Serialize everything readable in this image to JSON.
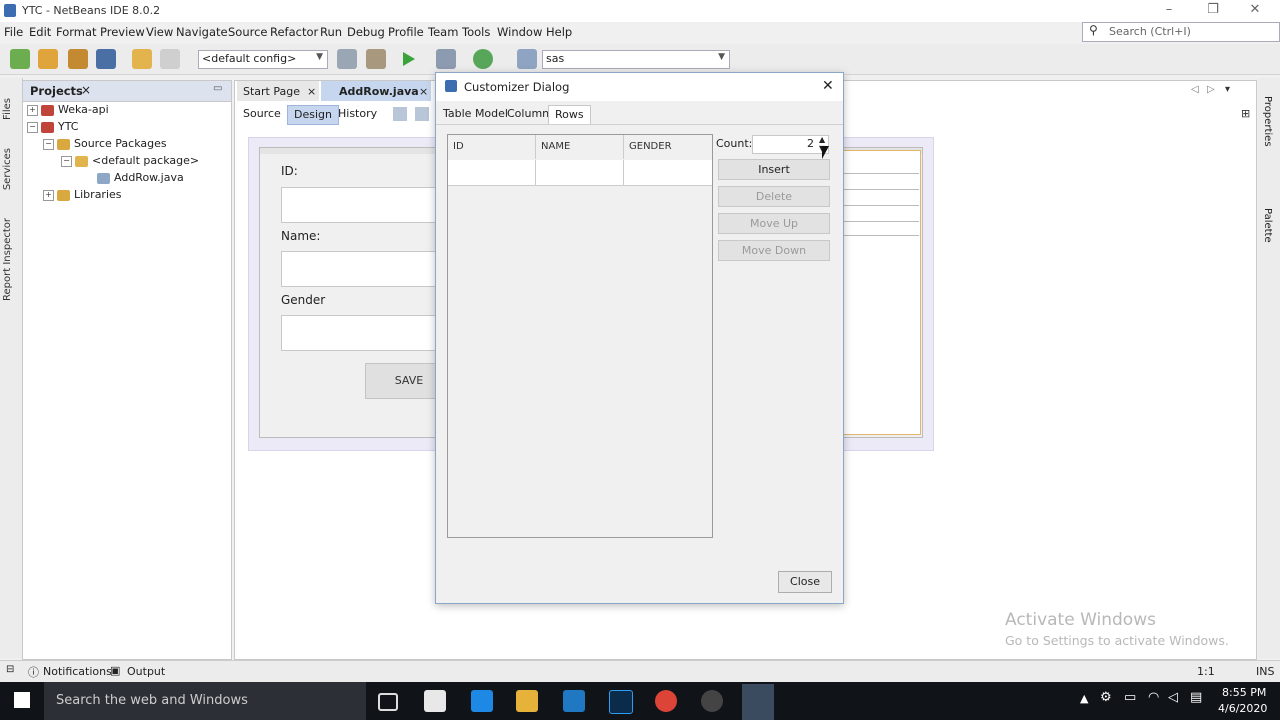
{
  "window": {
    "title": "YTC - NetBeans IDE 8.0.2",
    "search_placeholder": "Search (Ctrl+I)",
    "minimize": "–",
    "restore": "❐",
    "close": "✕"
  },
  "menu": [
    "File",
    "Edit",
    "Format",
    "Preview",
    "View",
    "Navigate",
    "Source",
    "Refactor",
    "Run",
    "Debug",
    "Profile",
    "Team",
    "Tools",
    "Window",
    "Help"
  ],
  "toolbar": {
    "config_combo": "<default config>",
    "profile_combo": "sas"
  },
  "side_tabs_left": [
    "Files",
    "Services",
    "Report Inspector"
  ],
  "side_tabs_right": [
    "Properties",
    "Palette"
  ],
  "projects": {
    "title": "Projects",
    "close": "×",
    "tree": [
      "Weka-api",
      "YTC",
      "Source Packages",
      "<default package>",
      "AddRow.java",
      "Libraries"
    ]
  },
  "editor": {
    "tabs": [
      "Start Page",
      "AddRow.java"
    ],
    "view_tabs": [
      "Source",
      "Design",
      "History"
    ],
    "form": {
      "id_label": "ID:",
      "name_label": "Name:",
      "gender_label": "Gender",
      "save_label": "SAVE"
    }
  },
  "dialog": {
    "title": "Customizer Dialog",
    "close_x": "✕",
    "tabs": [
      "Table Model",
      "Columns",
      "Rows"
    ],
    "active_tab": "Rows",
    "columns": [
      "ID",
      "NAME",
      "GENDER"
    ],
    "count_label": "Count:",
    "count_value": "2",
    "buttons": [
      "Insert",
      "Delete",
      "Move Up",
      "Move Down"
    ],
    "close_button": "Close"
  },
  "bottombar": {
    "notifications": "Notifications",
    "output": "Output",
    "position": "1:1",
    "mode": "INS"
  },
  "watermark": {
    "line1": "Activate Windows",
    "line2": "Go to Settings to activate Windows."
  },
  "taskbar": {
    "search": "Search the web and Windows",
    "time": "8:55 PM",
    "date": "4/6/2020"
  },
  "colors": {
    "accent": "#2f6fb5",
    "dialog_border": "#8aa6c8",
    "projects_header": "#dde3ee"
  }
}
